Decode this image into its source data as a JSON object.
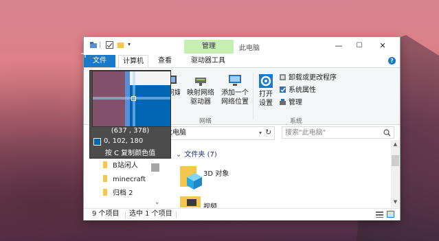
{
  "window": {
    "ribbon_context_tab": "管理",
    "title": "此电脑",
    "controls": [
      "—",
      "☐",
      "✕"
    ]
  },
  "tabs": {
    "file": "文件",
    "computer": "计算机",
    "view": "查看",
    "drive_tools": "驱动器工具"
  },
  "ribbon": {
    "media": "访问媒体",
    "map_drive": [
      "映射网络",
      "驱动器"
    ],
    "add_location": [
      "添加一个",
      "网络位置"
    ],
    "network_group": "网络",
    "open_settings": [
      "打开",
      "设置"
    ],
    "system_group": "系统",
    "uninstall": "卸载或更改程序",
    "sys_props": "系统属性",
    "manage": "管理"
  },
  "address": {
    "path": "此电脑",
    "search_placeholder": "搜索\"此电脑\""
  },
  "nav": {
    "items": [
      "B站闲人",
      "minecraft",
      "归档 2"
    ]
  },
  "content": {
    "section": "文件夹 (7)",
    "items": [
      "3D 对象",
      "视频"
    ]
  },
  "status": {
    "count": "9 个项目",
    "selected": "选中 1 个项目"
  },
  "magnifier": {
    "coords": "(637 , 378)",
    "rgb": "0, 102, 180",
    "hint": "按 C 复制颜色值",
    "swatch_color": "#0066b4"
  },
  "colors": {
    "accent": "#1979ca",
    "context_tab": "#c6efb1"
  }
}
